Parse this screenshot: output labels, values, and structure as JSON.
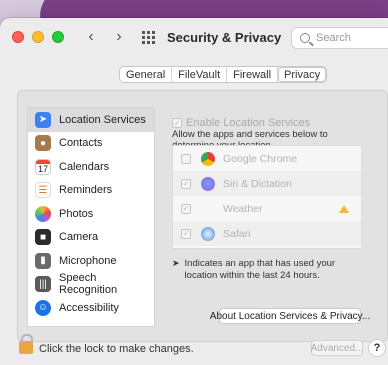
{
  "window": {
    "title": "Security & Privacy",
    "nav_back": "‹",
    "nav_forward": "›"
  },
  "search": {
    "placeholder": "Search"
  },
  "tabs": [
    {
      "label": "General",
      "active": false
    },
    {
      "label": "FileVault",
      "active": false
    },
    {
      "label": "Firewall",
      "active": false
    },
    {
      "label": "Privacy",
      "active": true
    }
  ],
  "sidebar": {
    "items": [
      {
        "label": "Location Services",
        "icon": "location-arrow-icon",
        "selected": true
      },
      {
        "label": "Contacts",
        "icon": "contacts-icon",
        "selected": false
      },
      {
        "label": "Calendars",
        "icon": "calendar-icon",
        "calendar_day": "17",
        "selected": false
      },
      {
        "label": "Reminders",
        "icon": "reminders-icon",
        "selected": false
      },
      {
        "label": "Photos",
        "icon": "photos-icon",
        "selected": false
      },
      {
        "label": "Camera",
        "icon": "camera-icon",
        "selected": false
      },
      {
        "label": "Microphone",
        "icon": "microphone-icon",
        "selected": false
      },
      {
        "label": "Speech Recognition",
        "icon": "speech-recognition-icon",
        "selected": false
      },
      {
        "label": "Accessibility",
        "icon": "accessibility-icon",
        "selected": false
      }
    ]
  },
  "location": {
    "enable_label": "Enable Location Services",
    "enable_checked": true,
    "description": "Allow the apps and services below to determine your location.",
    "apps": [
      {
        "name": "Google Chrome",
        "checked": false,
        "warning": false
      },
      {
        "name": "Siri & Dictation",
        "checked": true,
        "warning": false
      },
      {
        "name": "Weather",
        "checked": true,
        "warning": true
      },
      {
        "name": "Safari",
        "checked": true,
        "warning": false
      }
    ],
    "note": "Indicates an app that has used your location within the last 24 hours.",
    "about_button": "About Location Services & Privacy..."
  },
  "footer": {
    "lock_text": "Click the lock to make changes.",
    "advanced_button": "Advanced...",
    "help_button": "?"
  },
  "colors": {
    "selected_sidebar": "#dcdcdc",
    "accent": "#3a82f6",
    "warning": "#f3b63b"
  }
}
